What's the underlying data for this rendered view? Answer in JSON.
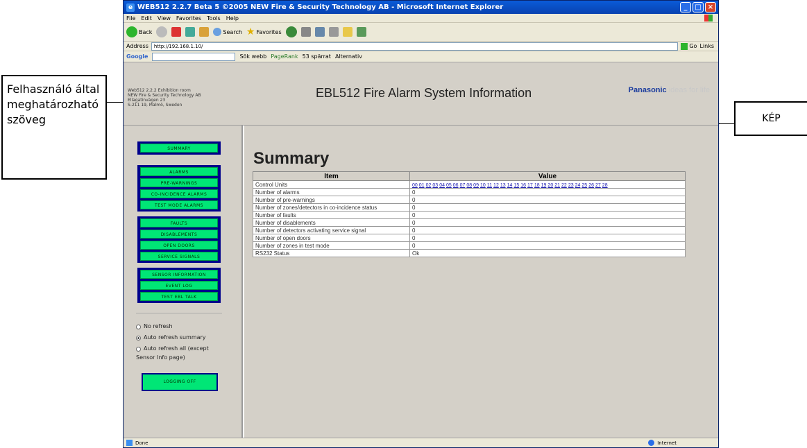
{
  "callouts": {
    "left_text": "Felhasználó által meghatározható szöveg",
    "right_text": "KÉP"
  },
  "browser": {
    "title": "WEB512 2.2.7 Beta 5 ©2005 NEW Fire & Security Technology AB - Microsoft Internet Explorer",
    "menu": [
      "File",
      "Edit",
      "View",
      "Favorites",
      "Tools",
      "Help"
    ],
    "toolbar": {
      "back": "Back",
      "search": "Search",
      "favorites": "Favorites"
    },
    "address_label": "Address",
    "address_value": "http://192.168.1.10/",
    "go_label": "Go",
    "links_label": "Links",
    "google_label": "Google",
    "google_items": [
      "Sök webb",
      "PageRank",
      "53 spärrat",
      "Alternativ"
    ],
    "status_left": "Done",
    "status_right": "Internet"
  },
  "header": {
    "address_lines": [
      "Web512 2.2.2 Exhibition room",
      "NEW Fire & Security Technology AB",
      "Ellagatinvägen 23",
      "S-211 19, Malmö, Sweden"
    ],
    "page_title": "EBL512 Fire Alarm System Information",
    "logo_brand": "Panasonic",
    "logo_slogan": "ideas for life"
  },
  "sidebar": {
    "group1": [
      "SUMMARY"
    ],
    "group2": [
      "ALARMS",
      "PRE-WARNINGS",
      "CO-INCIDENCE ALARMS",
      "TEST MODE ALARMS"
    ],
    "group3": [
      "FAULTS",
      "DISABLEMENTS",
      "OPEN DOORS",
      "SERVICE SIGNALS"
    ],
    "group4": [
      "SENSOR INFORMATION",
      "EVENT LOG",
      "TEST EBL TALK"
    ],
    "radios": [
      {
        "label": "No refresh",
        "checked": false
      },
      {
        "label": "Auto refresh summary",
        "checked": true
      },
      {
        "label": "Auto refresh all (except",
        "label2": "Sensor Info page)",
        "checked": false
      }
    ],
    "logoff_label": "LOGGING OFF"
  },
  "main": {
    "heading": "Summary",
    "table": {
      "headers": [
        "Item",
        "Value"
      ],
      "control_units_label": "Control Units",
      "control_units": [
        "00",
        "01",
        "02",
        "03",
        "04",
        "05",
        "06",
        "07",
        "08",
        "09",
        "10",
        "11",
        "12",
        "13",
        "14",
        "15",
        "16",
        "17",
        "18",
        "19",
        "20",
        "21",
        "22",
        "23",
        "24",
        "25",
        "26",
        "27",
        "28"
      ],
      "rows": [
        [
          "Number of alarms",
          "0"
        ],
        [
          "Number of pre-warnings",
          "0"
        ],
        [
          "Number of zones/detectors in co-incidence status",
          "0"
        ],
        [
          "Number of faults",
          "0"
        ],
        [
          "Number of disablements",
          "0"
        ],
        [
          "Number of detectors activating service signal",
          "0"
        ],
        [
          "Number of open doors",
          "0"
        ],
        [
          "Number of zones in test mode",
          "0"
        ],
        [
          "RS232 Status",
          "Ok"
        ]
      ]
    }
  }
}
